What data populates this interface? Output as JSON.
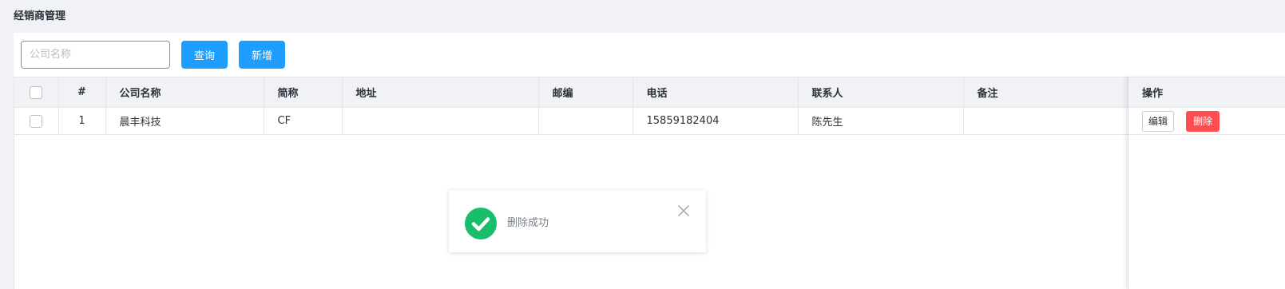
{
  "page": {
    "title": "经销商管理"
  },
  "toolbar": {
    "search_placeholder": "公司名称",
    "search_value": "",
    "query_label": "查询",
    "add_label": "新增"
  },
  "table": {
    "headers": [
      "#",
      "公司名称",
      "简称",
      "地址",
      "邮编",
      "电话",
      "联系人",
      "备注"
    ],
    "action_header": "操作",
    "rows": [
      {
        "index": "1",
        "company": "晨丰科技",
        "short_name": "CF",
        "address": "",
        "postcode": "",
        "phone": "15859182404",
        "contact": "陈先生",
        "remark": "",
        "edit_label": "编辑",
        "delete_label": "删除"
      }
    ]
  },
  "toast": {
    "message": "删除成功",
    "icon": "check-circle-icon",
    "close_icon": "close-icon"
  },
  "colors": {
    "primary": "#1e9fff",
    "danger": "#ff4d4f",
    "success": "#19be6b"
  }
}
